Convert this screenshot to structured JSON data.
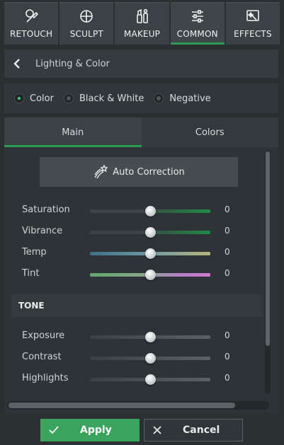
{
  "tabs": [
    {
      "label": "RETOUCH",
      "icon": "brush-face-icon"
    },
    {
      "label": "SCULPT",
      "icon": "sculpt-target-icon"
    },
    {
      "label": "MAKEUP",
      "icon": "makeup-icon"
    },
    {
      "label": "COMMON",
      "icon": "sliders-icon",
      "active": true
    },
    {
      "label": "EFFECTS",
      "icon": "effects-wand-icon"
    }
  ],
  "header": {
    "title": "Lighting & Color"
  },
  "mode": {
    "options": [
      "Color",
      "Black & White",
      "Negative"
    ],
    "selected": "Color"
  },
  "subtabs": [
    "Main",
    "Colors"
  ],
  "auto_correction": {
    "label": "Auto Correction"
  },
  "sliders": [
    {
      "label": "Saturation",
      "value": "0"
    },
    {
      "label": "Vibrance",
      "value": "0"
    },
    {
      "label": "Temp",
      "value": "0"
    },
    {
      "label": "Tint",
      "value": "0"
    }
  ],
  "tone": {
    "title": "TONE",
    "sliders": [
      {
        "label": "Exposure",
        "value": "0"
      },
      {
        "label": "Contrast",
        "value": "0"
      },
      {
        "label": "Highlights",
        "value": "0"
      }
    ]
  },
  "buttons": {
    "apply": "Apply",
    "cancel": "Cancel"
  },
  "colors": {
    "accent": "#2f9a52",
    "apply_bg": "#3aa35c",
    "panel_bg": "#2a2f31"
  }
}
